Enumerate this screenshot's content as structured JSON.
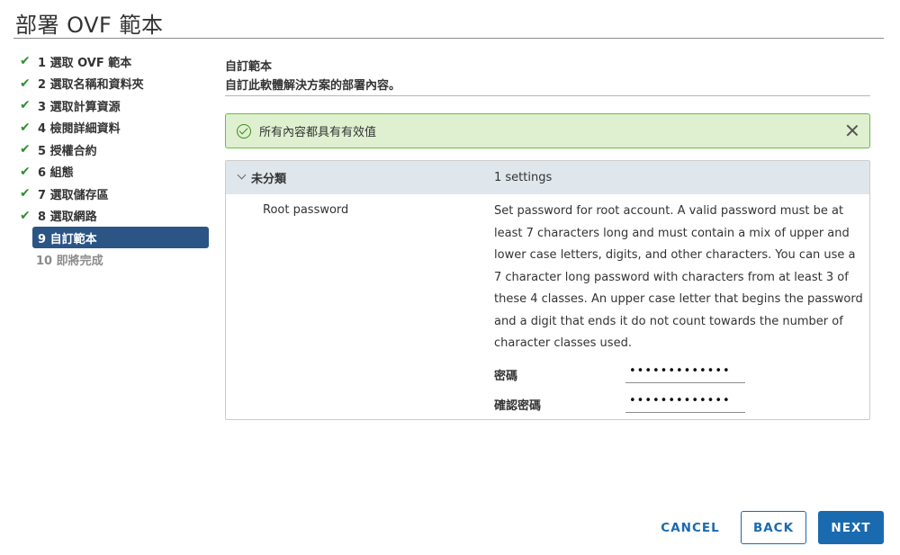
{
  "dialog": {
    "title": "部署 OVF 範本"
  },
  "steps": [
    {
      "label": "1 選取 OVF 範本",
      "state": "done"
    },
    {
      "label": "2 選取名稱和資料夾",
      "state": "done"
    },
    {
      "label": "3 選取計算資源",
      "state": "done"
    },
    {
      "label": "4 檢閱詳細資料",
      "state": "done"
    },
    {
      "label": "5 授權合約",
      "state": "done"
    },
    {
      "label": "6 組態",
      "state": "done"
    },
    {
      "label": "7 選取儲存區",
      "state": "done"
    },
    {
      "label": "8 選取網路",
      "state": "done"
    },
    {
      "label": "9 自訂範本",
      "state": "active"
    },
    {
      "label": "10 即將完成",
      "state": "disabled"
    }
  ],
  "section": {
    "title": "自訂範本",
    "description": "自訂此軟體解決方案的部署內容。"
  },
  "alert": {
    "text": "所有內容都具有有效值"
  },
  "grid": {
    "category": "未分類",
    "count": "1 settings",
    "property": {
      "name": "Root password",
      "description": "Set password for root account. A valid password must be at least 7 characters long and must contain a mix of upper and lower case letters, digits, and other characters. You can use a 7 character long password with characters from at least 3 of these 4 classes. An upper case letter that begins the password and a digit that ends it do not count towards the number of character classes used.",
      "password_label": "密碼",
      "password_value": "•••••••••••••",
      "confirm_label": "確認密碼",
      "confirm_value": "•••••••••••••"
    }
  },
  "footer": {
    "cancel": "CANCEL",
    "back": "BACK",
    "next": "NEXT"
  },
  "colors": {
    "accent": "#1a6ab0",
    "active_step": "#2b5585",
    "success_bg": "#dff0d0",
    "success_border": "#6abf3a",
    "check": "#2f8f2f"
  }
}
